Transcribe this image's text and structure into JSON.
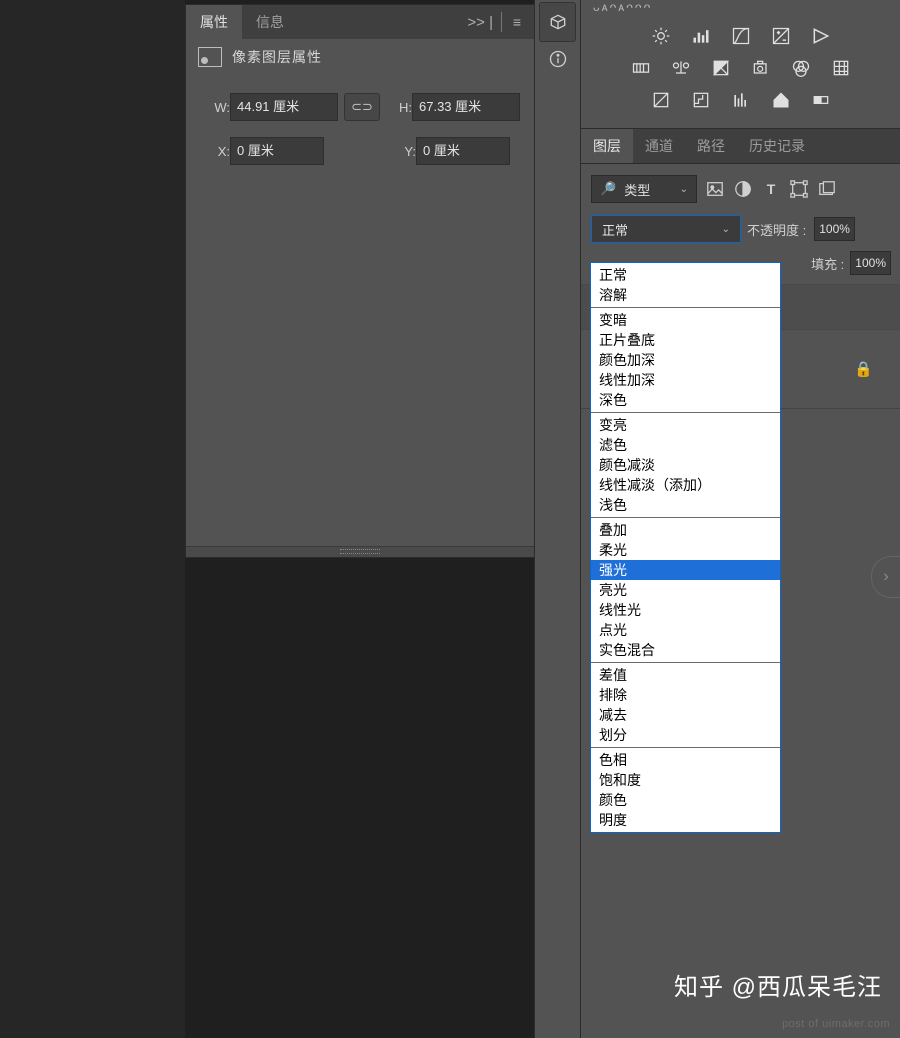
{
  "properties_panel": {
    "tabs": {
      "properties": "属性",
      "info": "信息"
    },
    "collapse": ">> |",
    "subtitle": "像素图层属性",
    "width_label": "W:",
    "width_value": "44.91 厘米",
    "height_label": "H:",
    "height_value": "67.33 厘米",
    "x_label": "X:",
    "x_value": "0 厘米",
    "y_label": "Y:",
    "y_value": "0 厘米",
    "link_icon": "⊂⊃"
  },
  "mid_strip": {
    "info_icon": "i"
  },
  "right_panel": {
    "header_text": "ᴗᴀᴖᴀᴖᴖᴖ",
    "tabs": {
      "layers": "图层",
      "channels": "通道",
      "paths": "路径",
      "history": "历史记录"
    },
    "kind_label": "类型",
    "kind_search": "🔎",
    "filter_T": "T",
    "blend_selected": "正常",
    "opacity_label": "不透明度 :",
    "opacity_value": "100%",
    "fill_label": "填充 :",
    "fill_value": "100%"
  },
  "blend_modes": {
    "g1": [
      "正常",
      "溶解"
    ],
    "g2": [
      "变暗",
      "正片叠底",
      "颜色加深",
      "线性加深",
      "深色"
    ],
    "g3": [
      "变亮",
      "滤色",
      "颜色减淡",
      "线性减淡（添加）",
      "浅色"
    ],
    "g4": [
      "叠加",
      "柔光",
      "强光",
      "亮光",
      "线性光",
      "点光",
      "实色混合"
    ],
    "g4_highlight_index": 2,
    "g5": [
      "差值",
      "排除",
      "减去",
      "划分"
    ],
    "g6": [
      "色相",
      "饱和度",
      "颜色",
      "明度"
    ]
  },
  "watermark": {
    "zhihu": "知乎 @西瓜呆毛汪",
    "site": "post of uimaker.com"
  },
  "nav_arrow": "›"
}
